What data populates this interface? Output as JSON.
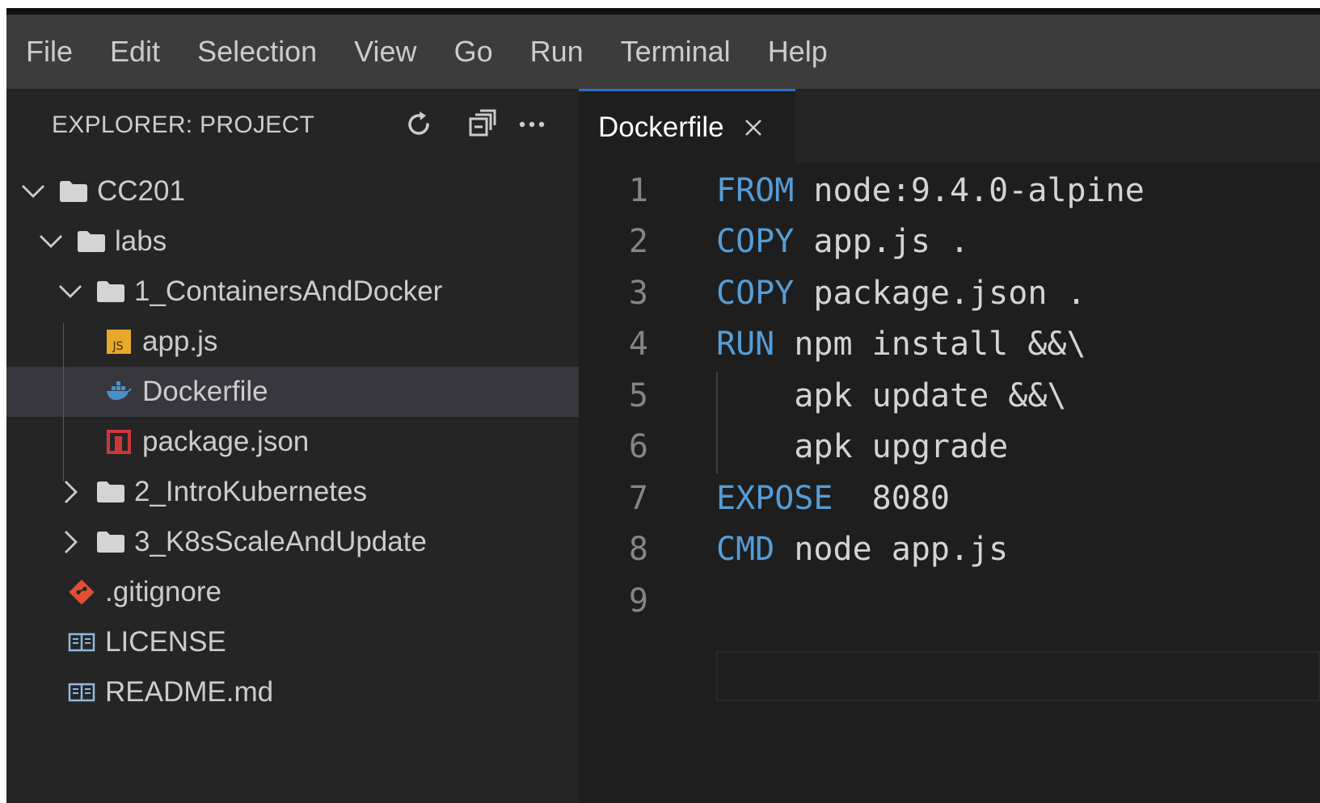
{
  "menu": [
    "File",
    "Edit",
    "Selection",
    "View",
    "Go",
    "Run",
    "Terminal",
    "Help"
  ],
  "explorer": {
    "title": "EXPLORER: PROJECT",
    "actions": [
      {
        "name": "refresh-icon"
      },
      {
        "name": "collapse-all-icon"
      },
      {
        "name": "more-actions-icon"
      }
    ]
  },
  "tree": [
    {
      "label": "CC201",
      "type": "folder",
      "expanded": true,
      "depth": 0
    },
    {
      "label": "labs",
      "type": "folder",
      "expanded": true,
      "depth": 1
    },
    {
      "label": "1_ContainersAndDocker",
      "type": "folder",
      "expanded": true,
      "depth": 2
    },
    {
      "label": "app.js",
      "type": "js",
      "depth": 3
    },
    {
      "label": "Dockerfile",
      "type": "docker",
      "depth": 3,
      "selected": true
    },
    {
      "label": "package.json",
      "type": "npm",
      "depth": 3
    },
    {
      "label": "2_IntroKubernetes",
      "type": "folder",
      "expanded": false,
      "depth": 2
    },
    {
      "label": "3_K8sScaleAndUpdate",
      "type": "folder",
      "expanded": false,
      "depth": 2
    },
    {
      "label": ".gitignore",
      "type": "git",
      "depth": 1
    },
    {
      "label": "LICENSE",
      "type": "doc",
      "depth": 1
    },
    {
      "label": "README.md",
      "type": "doc",
      "depth": 1
    }
  ],
  "editor": {
    "tab": {
      "label": "Dockerfile"
    },
    "lines": [
      {
        "n": "1",
        "kw": "FROM",
        "rest": " node:9.4.0-alpine"
      },
      {
        "n": "2",
        "kw": "COPY",
        "rest": " app.js ."
      },
      {
        "n": "3",
        "kw": "COPY",
        "rest": " package.json ."
      },
      {
        "n": "4",
        "kw": "RUN",
        "rest": " npm install &&\\"
      },
      {
        "n": "5",
        "kw": "",
        "rest": "    apk update &&\\"
      },
      {
        "n": "6",
        "kw": "",
        "rest": "    apk upgrade"
      },
      {
        "n": "7",
        "kw": "EXPOSE",
        "rest": "  8080"
      },
      {
        "n": "8",
        "kw": "CMD",
        "rest": " node app.js"
      },
      {
        "n": "9",
        "kw": "",
        "rest": ""
      }
    ]
  },
  "colors": {
    "keyword": "#569cd6",
    "text": "#d4d4d4",
    "menubar": "#3c3c3c",
    "sidebar": "#252526",
    "editor": "#1e1e1e",
    "selection": "#37373d",
    "tab_accent": "#2a6fc9"
  }
}
